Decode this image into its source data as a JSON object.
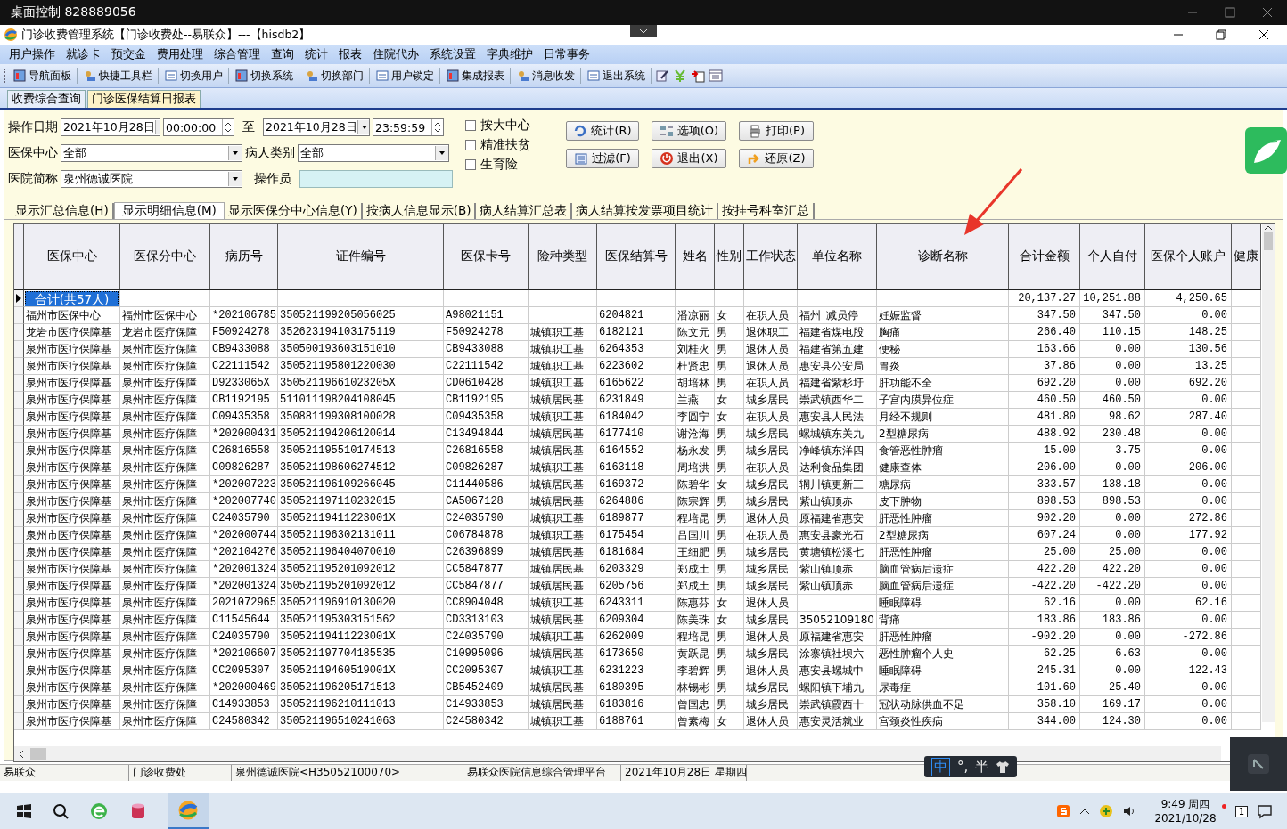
{
  "remote_bar": {
    "title": "桌面控制 828889056"
  },
  "window": {
    "title": "门诊收费管理系统【门诊收费处--易联众】---【hisdb2】"
  },
  "menu": [
    "用户操作",
    "就诊卡",
    "预交金",
    "费用处理",
    "综合管理",
    "查询",
    "统计",
    "报表",
    "住院代办",
    "系统设置",
    "字典维护",
    "日常事务"
  ],
  "toolbar": [
    "导航面板",
    "快捷工具栏",
    "切换用户",
    "切换系统",
    "切换部门",
    "用户锁定",
    "集成报表",
    "消息收发",
    "退出系统"
  ],
  "doc_tabs": [
    {
      "label": "收费综合查询",
      "selected": false
    },
    {
      "label": "门诊医保结算日报表",
      "selected": true
    }
  ],
  "filters": {
    "date_label": "操作日期",
    "date_from": "2021年10月28日",
    "time_from": "00:00:00",
    "to_label": "至",
    "date_to": "2021年10月28日",
    "time_to": "23:59:59",
    "center_label": "医保中心",
    "center": "全部",
    "category_label": "病人类别",
    "category": "全部",
    "hospital_label": "医院简称",
    "hospital": "泉州德诚医院",
    "operator_label": "操作员"
  },
  "checkboxes": [
    {
      "label": "按大中心",
      "checked": false
    },
    {
      "label": "精准扶贫",
      "checked": false
    },
    {
      "label": "生育险",
      "checked": false
    }
  ],
  "buttons": [
    "统计(R)",
    "选项(O)",
    "打印(P)",
    "过滤(F)",
    "退出(X)",
    "还原(Z)"
  ],
  "view_tabs": [
    {
      "label": "显示汇总信息(H)",
      "selected": false
    },
    {
      "label": "显示明细信息(M)",
      "selected": true
    },
    {
      "label": "显示医保分中心信息(Y)",
      "selected": false
    },
    {
      "label": "按病人信息显示(B)",
      "selected": false
    },
    {
      "label": "病人结算汇总表",
      "selected": false
    },
    {
      "label": "病人结算按发票项目统计",
      "selected": false
    },
    {
      "label": "按挂号科室汇总",
      "selected": false
    }
  ],
  "table": {
    "columns": [
      {
        "label": "医保中心",
        "kind": "text"
      },
      {
        "label": "医保分中心",
        "kind": "text"
      },
      {
        "label": "病历号",
        "kind": "code"
      },
      {
        "label": "证件编号",
        "kind": "code"
      },
      {
        "label": "医保卡号",
        "kind": "code"
      },
      {
        "label": "险种类型",
        "kind": "text"
      },
      {
        "label": "医保结算号",
        "kind": "code"
      },
      {
        "label": "姓名",
        "kind": "text"
      },
      {
        "label": "性别",
        "kind": "text"
      },
      {
        "label": "工作状态",
        "kind": "text"
      },
      {
        "label": "单位名称",
        "kind": "text"
      },
      {
        "label": "诊断名称",
        "kind": "text"
      },
      {
        "label": "合计金额",
        "kind": "money"
      },
      {
        "label": "个人自付",
        "kind": "money"
      },
      {
        "label": "医保个人账户",
        "kind": "money"
      },
      {
        "label": "健康",
        "kind": "text"
      }
    ],
    "total": {
      "label": "合计(共57人)",
      "selected": true,
      "values": [
        "20,137.27",
        "10,251.88",
        "4,250.65"
      ]
    },
    "rows": [
      {
        "selected": false,
        "cells": [
          "福州市医保中心",
          "福州市医保中心",
          "*202106785",
          "350521199205056025",
          "A98021151",
          null,
          "6204821",
          "潘凉丽",
          "女",
          "在职人员",
          "福州_减员停",
          "妊娠监督",
          "347.50",
          "347.50",
          "0.00"
        ]
      },
      {
        "selected": false,
        "cells": [
          "龙岩市医疗保障基",
          "龙岩市医疗保障",
          "F50924278",
          "352623194103175119",
          "F50924278",
          "城镇职工基",
          "6182121",
          "陈文元",
          "男",
          "退休职工",
          "福建省煤电股",
          "胸痛",
          "266.40",
          "110.15",
          "148.25"
        ]
      },
      {
        "selected": false,
        "cells": [
          "泉州市医疗保障基",
          "泉州市医疗保障",
          "CB9433088",
          "350500193603151010",
          "CB9433088",
          "城镇职工基",
          "6264353",
          "刘桂火",
          "男",
          "退休人员",
          "福建省第五建",
          "便秘",
          "163.66",
          "0.00",
          "130.56"
        ]
      },
      {
        "selected": false,
        "cells": [
          "泉州市医疗保障基",
          "泉州市医疗保障",
          "C22111542",
          "350521195801220030",
          "C22111542",
          "城镇职工基",
          "6223602",
          "杜贤忠",
          "男",
          "退休人员",
          "惠安县公安局",
          "胃炎",
          "37.86",
          "0.00",
          "13.25"
        ]
      },
      {
        "selected": false,
        "cells": [
          "泉州市医疗保障基",
          "泉州市医疗保障",
          "D9233065X",
          "35052119661023205X",
          "CD0610428",
          "城镇职工基",
          "6165622",
          "胡培林",
          "男",
          "在职人员",
          "福建省紫杉圩",
          "肝功能不全",
          "692.20",
          "0.00",
          "692.20"
        ]
      },
      {
        "selected": false,
        "cells": [
          "泉州市医疗保障基",
          "泉州市医疗保障",
          "CB1192195",
          "511011198204108045",
          "CB1192195",
          "城镇居民基",
          "6231849",
          "兰燕",
          "女",
          "城乡居民",
          "崇武镇西华二",
          "子宫内膜异位症",
          "460.50",
          "460.50",
          "0.00"
        ]
      },
      {
        "selected": false,
        "cells": [
          "泉州市医疗保障基",
          "泉州市医疗保障",
          "C09435358",
          "350881199308100028",
          "C09435358",
          "城镇职工基",
          "6184042",
          "李圆宁",
          "女",
          "在职人员",
          "惠安县人民法",
          "月经不规则",
          "481.80",
          "98.62",
          "287.40"
        ]
      },
      {
        "selected": false,
        "cells": [
          "泉州市医疗保障基",
          "泉州市医疗保障",
          "*202000431",
          "350521194206120014",
          "C13494844",
          "城镇居民基",
          "6177410",
          "谢沧海",
          "男",
          "城乡居民",
          "螺城镇东关九",
          "2型糖尿病",
          "488.92",
          "230.48",
          "0.00"
        ]
      },
      {
        "selected": false,
        "cells": [
          "泉州市医疗保障基",
          "泉州市医疗保障",
          "C26816558",
          "350521195510174513",
          "C26816558",
          "城镇居民基",
          "6164552",
          "杨永发",
          "男",
          "城乡居民",
          "净峰镇东洋四",
          "食管恶性肿瘤",
          "15.00",
          "3.75",
          "0.00"
        ]
      },
      {
        "selected": false,
        "cells": [
          "泉州市医疗保障基",
          "泉州市医疗保障",
          "C09826287",
          "350521198606274512",
          "C09826287",
          "城镇职工基",
          "6163118",
          "周培洪",
          "男",
          "在职人员",
          "达利食品集团",
          "健康查体",
          "206.00",
          "0.00",
          "206.00"
        ]
      },
      {
        "selected": false,
        "cells": [
          "泉州市医疗保障基",
          "泉州市医疗保障",
          "*202007223",
          "350521196109266045",
          "C11440586",
          "城镇居民基",
          "6169372",
          "陈碧华",
          "女",
          "城乡居民",
          "辋川镇更新三",
          "糖尿病",
          "333.57",
          "138.18",
          "0.00"
        ]
      },
      {
        "selected": false,
        "cells": [
          "泉州市医疗保障基",
          "泉州市医疗保障",
          "*202007740",
          "350521197110232015",
          "CA5067128",
          "城镇居民基",
          "6264886",
          "陈宗辉",
          "男",
          "城乡居民",
          "紫山镇顶赤",
          "皮下肿物",
          "898.53",
          "898.53",
          "0.00"
        ]
      },
      {
        "selected": false,
        "cells": [
          "泉州市医疗保障基",
          "泉州市医疗保障",
          "C24035790",
          "35052119411223001X",
          "C24035790",
          "城镇职工基",
          "6189877",
          "程培昆",
          "男",
          "退休人员",
          "原福建省惠安",
          "肝恶性肿瘤",
          "902.20",
          "0.00",
          "272.86"
        ]
      },
      {
        "selected": false,
        "cells": [
          "泉州市医疗保障基",
          "泉州市医疗保障",
          "*202000744",
          "350521196302131011",
          "C06784878",
          "城镇职工基",
          "6175454",
          "吕国川",
          "男",
          "在职人员",
          "惠安县豪光石",
          "2型糖尿病",
          "607.24",
          "0.00",
          "177.92"
        ]
      },
      {
        "selected": false,
        "cells": [
          "泉州市医疗保障基",
          "泉州市医疗保障",
          "*202104276",
          "350521196404070010",
          "C26396899",
          "城镇居民基",
          "6181684",
          "王细肥",
          "男",
          "城乡居民",
          "黄塘镇松溪七",
          "肝恶性肿瘤",
          "25.00",
          "25.00",
          "0.00"
        ]
      },
      {
        "selected": false,
        "cells": [
          "泉州市医疗保障基",
          "泉州市医疗保障",
          "*202001324",
          "350521195201092012",
          "CC5847877",
          "城镇居民基",
          "6203329",
          "郑成土",
          "男",
          "城乡居民",
          "紫山镇顶赤",
          "脑血管病后遗症",
          "422.20",
          "422.20",
          "0.00"
        ]
      },
      {
        "selected": false,
        "cells": [
          "泉州市医疗保障基",
          "泉州市医疗保障",
          "*202001324",
          "350521195201092012",
          "CC5847877",
          "城镇居民基",
          "6205756",
          "郑成土",
          "男",
          "城乡居民",
          "紫山镇顶赤",
          "脑血管病后遗症",
          "-422.20",
          "-422.20",
          "0.00"
        ]
      },
      {
        "selected": false,
        "cells": [
          "泉州市医疗保障基",
          "泉州市医疗保障",
          "2021072965",
          "350521196910130020",
          "CC8904048",
          "城镇职工基",
          "6243311",
          "陈惠芬",
          "女",
          "退休人员",
          null,
          "睡眠障碍",
          "62.16",
          "0.00",
          "62.16"
        ]
      },
      {
        "selected": false,
        "cells": [
          "泉州市医疗保障基",
          "泉州市医疗保障",
          "C11545644",
          "350521195303151562",
          "CD3313103",
          "城镇居民基",
          "6209304",
          "陈美珠",
          "女",
          "城乡居民",
          "35052109180",
          "背痛",
          "183.86",
          "183.86",
          "0.00"
        ]
      },
      {
        "selected": false,
        "cells": [
          "泉州市医疗保障基",
          "泉州市医疗保障",
          "C24035790",
          "35052119411223001X",
          "C24035790",
          "城镇职工基",
          "6262009",
          "程培昆",
          "男",
          "退休人员",
          "原福建省惠安",
          "肝恶性肿瘤",
          "-902.20",
          "0.00",
          "-272.86"
        ]
      },
      {
        "selected": false,
        "cells": [
          "泉州市医疗保障基",
          "泉州市医疗保障",
          "*202106607",
          "350521197704185535",
          "C10995096",
          "城镇居民基",
          "6173650",
          "黄跃昆",
          "男",
          "城乡居民",
          "涂寨镇社坝六",
          "恶性肿瘤个人史",
          "62.25",
          "6.63",
          "0.00"
        ]
      },
      {
        "selected": false,
        "cells": [
          "泉州市医疗保障基",
          "泉州市医疗保障",
          "CC2095307",
          "35052119460519001X",
          "CC2095307",
          "城镇职工基",
          "6231223",
          "李碧辉",
          "男",
          "退休人员",
          "惠安县螺城中",
          "睡眠障碍",
          "245.31",
          "0.00",
          "122.43"
        ]
      },
      {
        "selected": false,
        "cells": [
          "泉州市医疗保障基",
          "泉州市医疗保障",
          "*202000469",
          "350521196205171513",
          "CB5452409",
          "城镇居民基",
          "6180395",
          "林锡彬",
          "男",
          "城乡居民",
          "螺阳镇下埔九",
          "尿毒症",
          "101.60",
          "25.40",
          "0.00"
        ]
      },
      {
        "selected": false,
        "cells": [
          "泉州市医疗保障基",
          "泉州市医疗保障",
          "C14933853",
          "350521196210111013",
          "C14933853",
          "城镇居民基",
          "6183816",
          "曾国忠",
          "男",
          "城乡居民",
          "崇武镇霞西十",
          "冠状动脉供血不足",
          "358.10",
          "169.17",
          "0.00"
        ]
      },
      {
        "selected": false,
        "cells": [
          "泉州市医疗保障基",
          "泉州市医疗保障",
          "C24580342",
          "350521196510241063",
          "C24580342",
          "城镇职工基",
          "6188761",
          "曾素梅",
          "女",
          "退休人员",
          "惠安灵活就业",
          "宫颈炎性疾病",
          "344.00",
          "124.30",
          "0.00"
        ]
      }
    ]
  },
  "status_bar": [
    "易联众",
    "门诊收费处",
    "泉州德诚医院<H35052100070>",
    "易联众医院信息综合管理平台",
    "2021年10月28日 星期四"
  ],
  "ime": [
    "中",
    "°,",
    "半"
  ],
  "taskbar": {
    "time": "9:49 周四",
    "date": "2021/10/28",
    "notifications": "1"
  }
}
